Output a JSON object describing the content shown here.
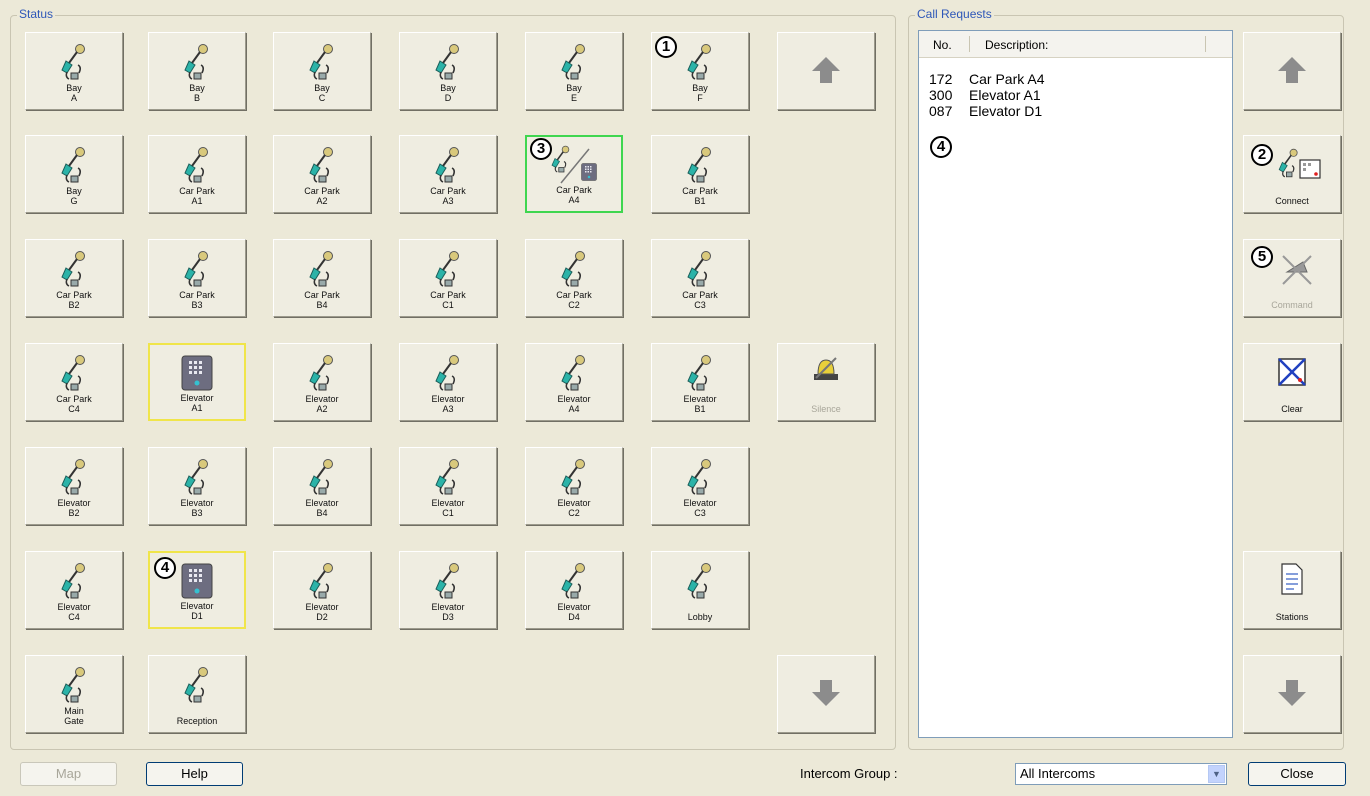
{
  "status": {
    "title": "Status",
    "tiles": [
      {
        "label": "Bay\nA"
      },
      {
        "label": "Bay\nB"
      },
      {
        "label": "Bay\nC"
      },
      {
        "label": "Bay\nD"
      },
      {
        "label": "Bay\nE"
      },
      {
        "label": "Bay\nF"
      },
      {
        "label": "Bay\nG"
      },
      {
        "label": "Car Park\nA1"
      },
      {
        "label": "Car Park\nA2"
      },
      {
        "label": "Car Park\nA3"
      },
      {
        "label": "Car Park\nA4"
      },
      {
        "label": "Car Park\nB1"
      },
      {
        "label": "Car Park\nB2"
      },
      {
        "label": "Car Park\nB3"
      },
      {
        "label": "Car Park\nB4"
      },
      {
        "label": "Car Park\nC1"
      },
      {
        "label": "Car Park\nC2"
      },
      {
        "label": "Car Park\nC3"
      },
      {
        "label": "Car Park\nC4"
      },
      {
        "label": "Elevator\nA1"
      },
      {
        "label": "Elevator\nA2"
      },
      {
        "label": "Elevator\nA3"
      },
      {
        "label": "Elevator\nA4"
      },
      {
        "label": "Elevator\nB1"
      },
      {
        "label": "Elevator\nB2"
      },
      {
        "label": "Elevator\nB3"
      },
      {
        "label": "Elevator\nB4"
      },
      {
        "label": "Elevator\nC1"
      },
      {
        "label": "Elevator\nC2"
      },
      {
        "label": "Elevator\nC3"
      },
      {
        "label": "Elevator\nC4"
      },
      {
        "label": "Elevator\nD1"
      },
      {
        "label": "Elevator\nD2"
      },
      {
        "label": "Elevator\nD3"
      },
      {
        "label": "Elevator\nD4"
      },
      {
        "label": "Lobby"
      },
      {
        "label": "Main\nGate"
      },
      {
        "label": "Reception"
      }
    ],
    "silence_label": "Silence",
    "scroll_up_icon": "arrow-up-icon",
    "scroll_down_icon": "arrow-down-icon"
  },
  "call_requests": {
    "title": "Call Requests",
    "columns": {
      "no": "No.",
      "description": "Description:"
    },
    "rows": [
      {
        "no": "172",
        "description": "Car Park A4"
      },
      {
        "no": "300",
        "description": "Elevator A1"
      },
      {
        "no": "087",
        "description": "Elevator D1"
      }
    ],
    "buttons": {
      "connect": "Connect",
      "command": "Command",
      "clear": "Clear",
      "stations": "Stations"
    }
  },
  "callouts": {
    "one": "1",
    "two": "2",
    "three": "3",
    "four_tile": "4",
    "four_list": "4",
    "five": "5"
  },
  "footer": {
    "map": "Map",
    "help": "Help",
    "intercom_group_label": "Intercom Group :",
    "intercom_group_value": "All Intercoms",
    "close": "Close"
  },
  "colors": {
    "background": "#ece9d8",
    "legend_blue": "#2e57b8",
    "selected_yellow": "#f0e54a",
    "selected_green": "#3fd64f"
  }
}
